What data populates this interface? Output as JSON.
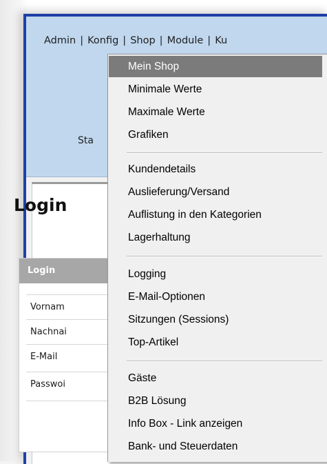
{
  "topnav": {
    "items": [
      "Admin",
      "Konfig",
      "Shop",
      "Module",
      "Ku"
    ],
    "separator": "|"
  },
  "header": {
    "truncated_text": "Sta"
  },
  "page": {
    "title": "Login"
  },
  "login_box": {
    "header": "Login",
    "fields": [
      "Vornam",
      "Nachnai",
      "E-Mail",
      "Passwoi"
    ]
  },
  "menu": {
    "groups": [
      [
        "Mein Shop",
        "Minimale Werte",
        "Maximale Werte",
        "Grafiken"
      ],
      [
        "Kundendetails",
        "Auslieferung/Versand",
        "Auflistung in den Kategorien",
        "Lagerhaltung"
      ],
      [
        "Logging",
        "E-Mail-Optionen",
        "Sitzungen (Sessions)",
        "Top-Artikel"
      ],
      [
        "Gäste",
        "B2B Lösung",
        "Info Box - Link anzeigen",
        "Bank- und Steuerdaten"
      ]
    ],
    "selected": "Mein Shop"
  },
  "colors": {
    "header_bg": "#c0d7ee",
    "window_border": "#1e3fa6",
    "menu_selected": "#7b7b7b",
    "login_header_bg": "#a7a7a7"
  }
}
